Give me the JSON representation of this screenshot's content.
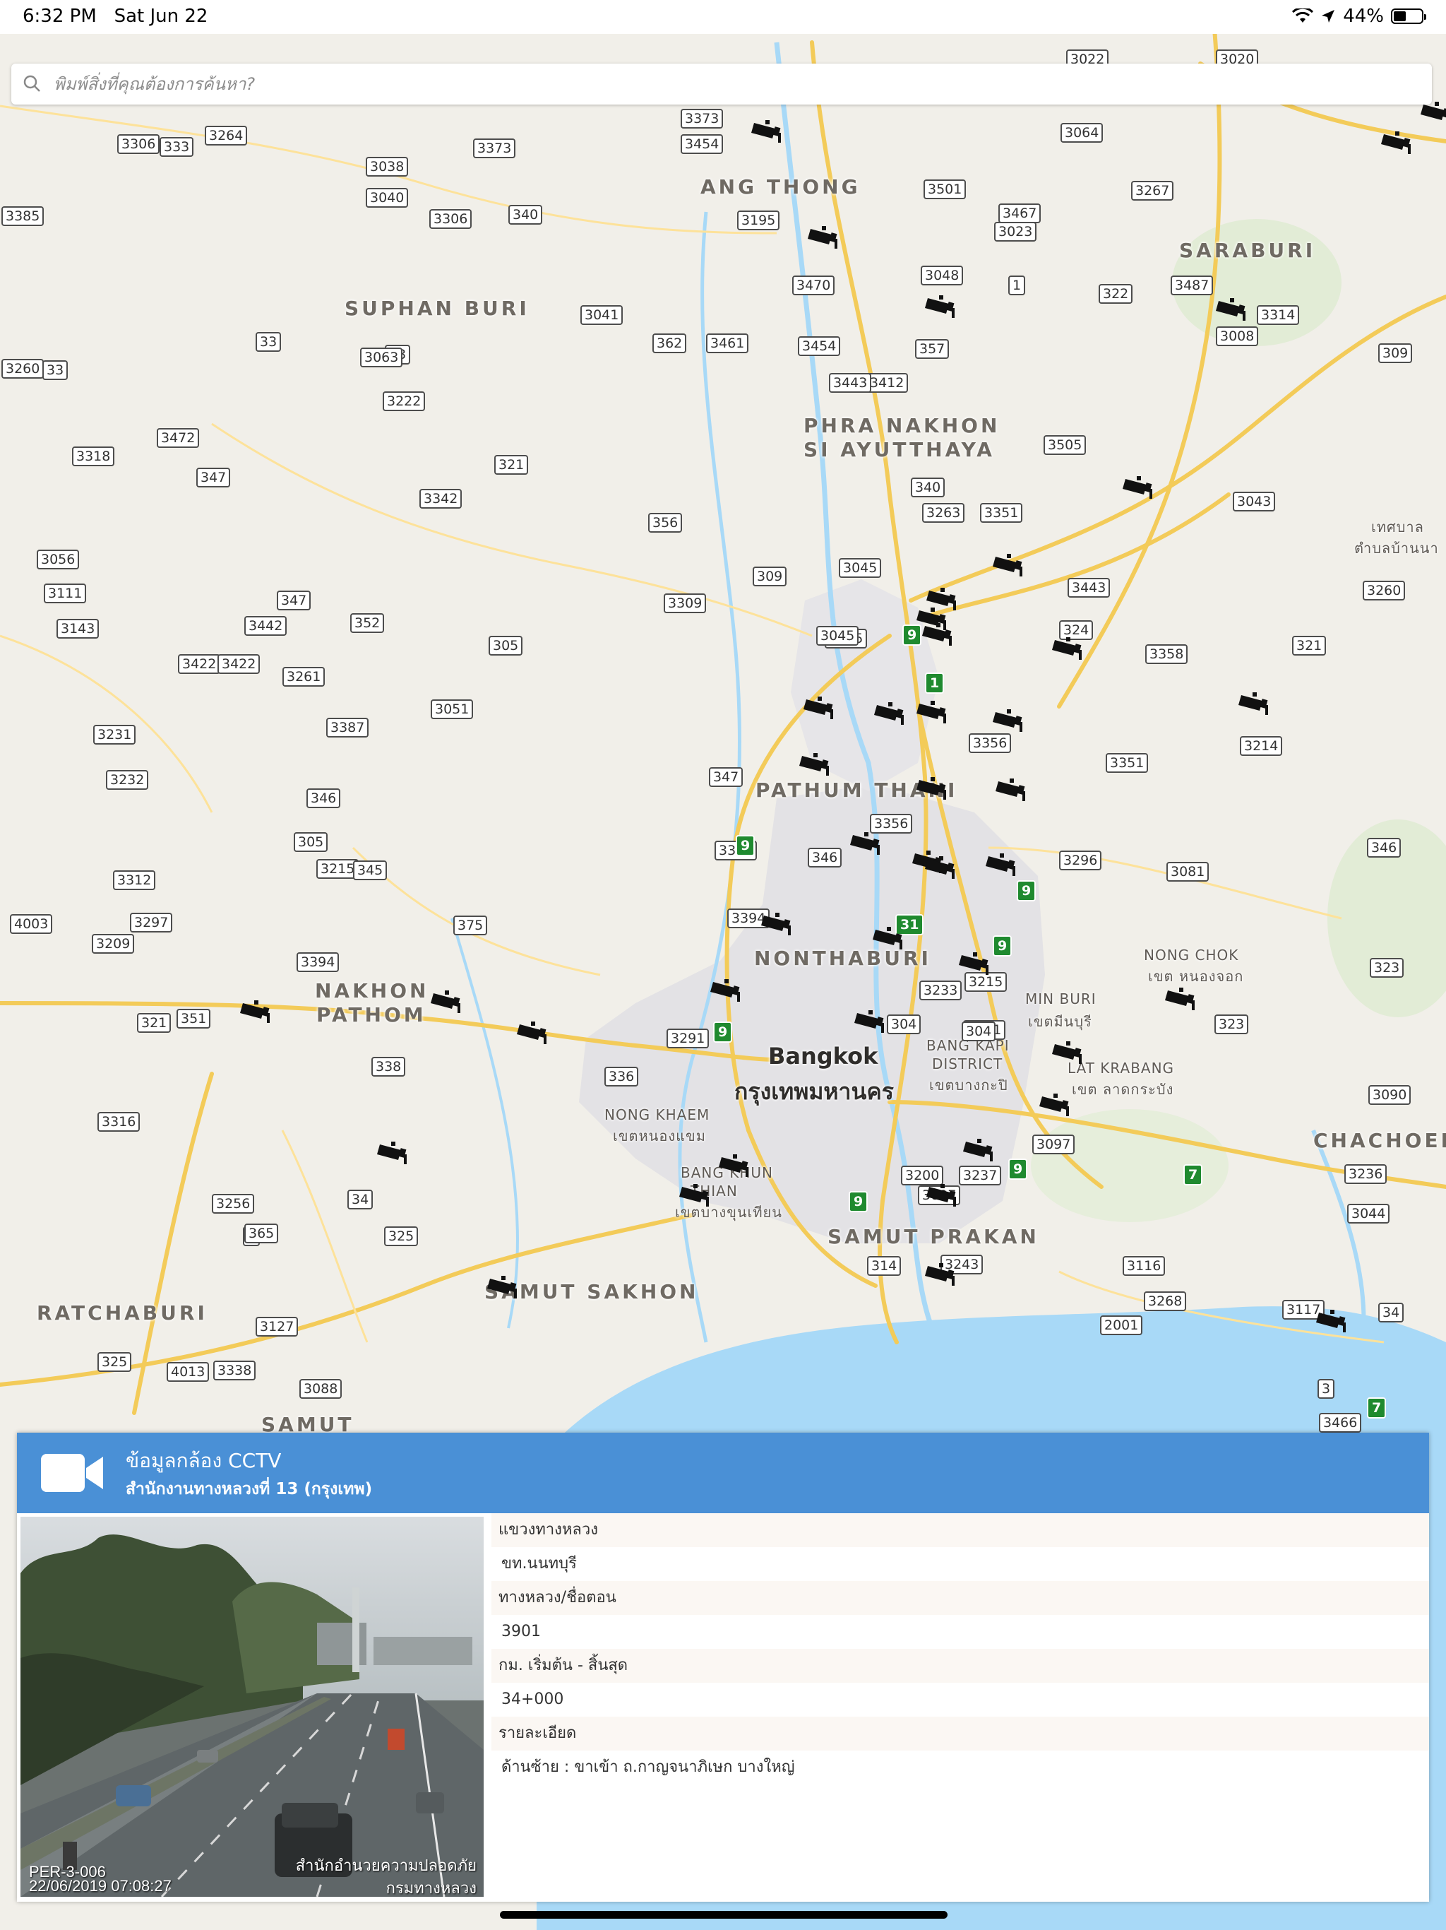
{
  "status_bar": {
    "time": "6:32 PM",
    "date": "Sat Jun 22",
    "battery": "44%",
    "battery_level": 0.44
  },
  "search": {
    "placeholder": "พิมพ์สิ่งที่คุณต้องการค้นหา?"
  },
  "map": {
    "places": [
      {
        "label": "ANG THONG"
      },
      {
        "label": "SARABURI"
      },
      {
        "label": "SUPHAN BURI"
      },
      {
        "label": "PHRA NAKHON"
      },
      {
        "label": "SI AYUTTHAYA"
      },
      {
        "label": "PATHUM THANI"
      },
      {
        "label": "NONTHABURI"
      },
      {
        "label": "NAKHON"
      },
      {
        "label": "PATHOM"
      },
      {
        "label": "Bangkok"
      },
      {
        "label": "กรุงเทพมหานคร"
      },
      {
        "label": "NONG KHAEM"
      },
      {
        "label": "เขตหนองแขม"
      },
      {
        "label": "BANG KHUN"
      },
      {
        "label": "THIAN"
      },
      {
        "label": "เขตบางขุนเทียน"
      },
      {
        "label": "SAMUT PRAKAN"
      },
      {
        "label": "SAMUT SAKHON"
      },
      {
        "label": "RATCHABURI"
      },
      {
        "label": "SAMUT"
      },
      {
        "label": "MIN BURI"
      },
      {
        "label": "เขตมีนบุรี"
      },
      {
        "label": "BANG KAPI"
      },
      {
        "label": "DISTRICT"
      },
      {
        "label": "เขตบางกะปิ"
      },
      {
        "label": "LAT KRABANG"
      },
      {
        "label": "เขต ลาดกระบัง"
      },
      {
        "label": "NONG CHOK"
      },
      {
        "label": "เขต หนองจอก"
      },
      {
        "label": "CHACHOENG"
      },
      {
        "label": "เทศบาล"
      },
      {
        "label": "ตำบลบ้านนา"
      }
    ],
    "route_shields": [
      "3306",
      "333",
      "3264",
      "3038",
      "3040",
      "3373",
      "3373",
      "3454",
      "3064",
      "3022",
      "3020",
      "3385",
      "3306",
      "340",
      "3195",
      "3501",
      "3267",
      "3048",
      "3023",
      "3467",
      "1",
      "322",
      "3487",
      "3008",
      "3470",
      "3041",
      "3314",
      "33",
      "33",
      "362",
      "3461",
      "357",
      "3454",
      "3412",
      "3063",
      "309",
      "3260",
      "33",
      "3222",
      "3443",
      "3472",
      "3318",
      "347",
      "321",
      "3342",
      "3505",
      "340",
      "3263",
      "3351",
      "3043",
      "356",
      "3056",
      "309",
      "3045",
      "3125",
      "3443",
      "3111",
      "347",
      "3309",
      "3045",
      "324",
      "3260",
      "3143",
      "3442",
      "352",
      "305",
      "3358",
      "321",
      "3422",
      "3422",
      "3261",
      "3051",
      "3356",
      "3387",
      "3231",
      "3351",
      "3214",
      "3232",
      "3356",
      "346",
      "347",
      "305",
      "3369",
      "346",
      "3081",
      "3296",
      "346",
      "3215",
      "345",
      "3312",
      "4003",
      "3297",
      "375",
      "3394",
      "3209",
      "3394",
      "3233",
      "3215",
      "323",
      "321",
      "351",
      "304",
      "3481",
      "3291",
      "323",
      "336",
      "338",
      "304",
      "3316",
      "3097",
      "3090",
      "3256",
      "3200",
      "3237",
      "3236",
      "3",
      "34",
      "365",
      "325",
      "3097",
      "3044",
      "314",
      "3243",
      "3116",
      "3268",
      "3117",
      "34",
      "3127",
      "325",
      "3338",
      "4013",
      "3088",
      "2001",
      "3",
      "3466",
      "3",
      "315"
    ],
    "green_shields": [
      "9",
      "1",
      "9",
      "9",
      "31",
      "9",
      "9",
      "7",
      "9",
      "9",
      "7"
    ]
  },
  "panel": {
    "title": "ข้อมูลกล้อง CCTV",
    "subtitle": "สำนักงานทางหลวงที่ 13 (กรุงเทพ)",
    "image": {
      "camera_code": "PER-3-006",
      "timestamp": "22/06/2019 07:08:27",
      "agency_line1": "สำนักอำนวยความปลอดภัย",
      "agency_line2": "กรมทางหลวง"
    },
    "fields": [
      {
        "label": "แขวงทางหลวง",
        "value": "ขท.นนทบุรี"
      },
      {
        "label": "ทางหลวง/ชื่อตอน",
        "value": "3901"
      },
      {
        "label": "กม. เริ่มต้น - สิ้นสุด",
        "value": "34+000"
      },
      {
        "label": "รายละเอียด",
        "value": "ด้านซ้าย : ขาเข้า ถ.กาญจนาภิเษก บางใหญ่"
      }
    ],
    "colors": {
      "header": "#4a90d6"
    }
  }
}
